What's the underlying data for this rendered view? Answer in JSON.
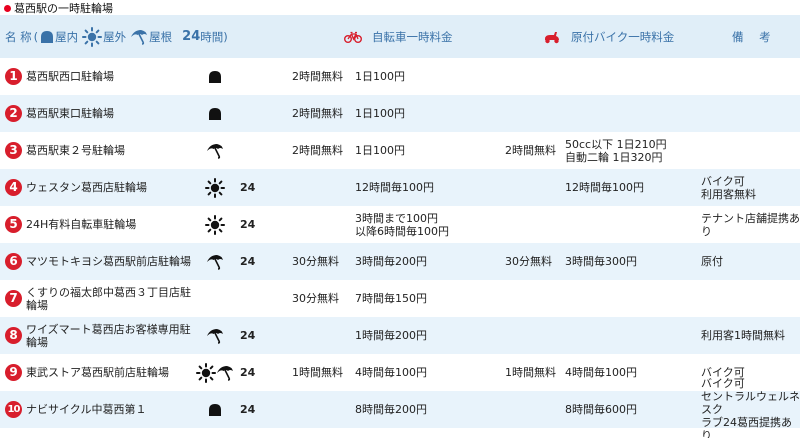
{
  "page_title": "葛西駅の一時駐輪場",
  "header": {
    "name_label": "名 称",
    "paren_open": "(",
    "paren_close": ")",
    "indoor_label": "屋内",
    "outdoor_label": "屋外",
    "roof_label": "屋根",
    "h24_label": "24",
    "h24_suffix": "時間",
    "bike_fee_label": "自転車一時料金",
    "moped_fee_label": "原付バイク一時料金",
    "notes_label": "備 考"
  },
  "colors": {
    "accent_red": "#d81e2c",
    "header_bg": "#e0eef8",
    "header_text": "#3a72a8",
    "row_alt": "#e8f3fb"
  },
  "rows": [
    {
      "num": "1",
      "name": "葛西駅西口駐輪場",
      "icons": [
        "indoor"
      ],
      "h24": "",
      "bike_free": "2時間無料",
      "bike_fee": "1日100円",
      "moped_free": "",
      "moped_fee": "",
      "note": ""
    },
    {
      "num": "2",
      "name": "葛西駅東口駐輪場",
      "icons": [
        "indoor"
      ],
      "h24": "",
      "bike_free": "2時間無料",
      "bike_fee": "1日100円",
      "moped_free": "",
      "moped_fee": "",
      "note": ""
    },
    {
      "num": "3",
      "name": "葛西駅東２号駐輪場",
      "icons": [
        "roof"
      ],
      "h24": "",
      "bike_free": "2時間無料",
      "bike_fee": "1日100円",
      "moped_free": "2時間無料",
      "moped_fee": [
        "50cc以下 1日210円",
        "自動二輪 1日320円"
      ],
      "note": ""
    },
    {
      "num": "4",
      "name": "ウェスタン葛西店駐輪場",
      "icons": [
        "outdoor"
      ],
      "h24": "24",
      "bike_free": "",
      "bike_fee": "12時間毎100円",
      "moped_free": "",
      "moped_fee": "12時間毎100円",
      "note": [
        "バイク可",
        "利用客無料"
      ]
    },
    {
      "num": "5",
      "name": "24H有料自転車駐輪場",
      "icons": [
        "outdoor"
      ],
      "h24": "24",
      "bike_free": "",
      "bike_fee": [
        "3時間まで100円",
        "以降6時間毎100円"
      ],
      "moped_free": "",
      "moped_fee": "",
      "note": "テナント店舗提携あり"
    },
    {
      "num": "6",
      "name": "マツモトキヨシ葛西駅前店駐輪場",
      "icons": [
        "roof"
      ],
      "h24": "24",
      "bike_free": "30分無料",
      "bike_fee": "3時間毎200円",
      "moped_free": "30分無料",
      "moped_fee": "3時間毎300円",
      "note": "原付"
    },
    {
      "num": "7",
      "name": [
        "くすりの福太郎中葛西３丁目店駐",
        "輪場"
      ],
      "icons": [],
      "h24": "",
      "bike_free": "30分無料",
      "bike_fee": "7時間毎150円",
      "moped_free": "",
      "moped_fee": "",
      "note": ""
    },
    {
      "num": "8",
      "name": [
        "ワイズマート葛西店お客様専用駐",
        "輪場"
      ],
      "icons": [
        "roof"
      ],
      "h24": "24",
      "bike_free": "",
      "bike_fee": "1時間毎200円",
      "moped_free": "",
      "moped_fee": "",
      "note": "利用客1時間無料"
    },
    {
      "num": "9",
      "name": "東武ストア葛西駅前店駐輪場",
      "icons": [
        "outdoor",
        "roof"
      ],
      "h24": "24",
      "bike_free": "1時間無料",
      "bike_fee": "4時間毎100円",
      "moped_free": "1時間無料",
      "moped_fee": "4時間毎100円",
      "note": "バイク可"
    },
    {
      "num": "10",
      "name": "ナビサイクル中葛西第１",
      "icons": [
        "indoor"
      ],
      "h24": "24",
      "bike_free": "",
      "bike_fee": "8時間毎200円",
      "moped_free": "",
      "moped_fee": "8時間毎600円",
      "note": [
        "バイク可",
        "セントラルウェルネスク",
        "ラブ24葛西提携あり"
      ]
    }
  ]
}
